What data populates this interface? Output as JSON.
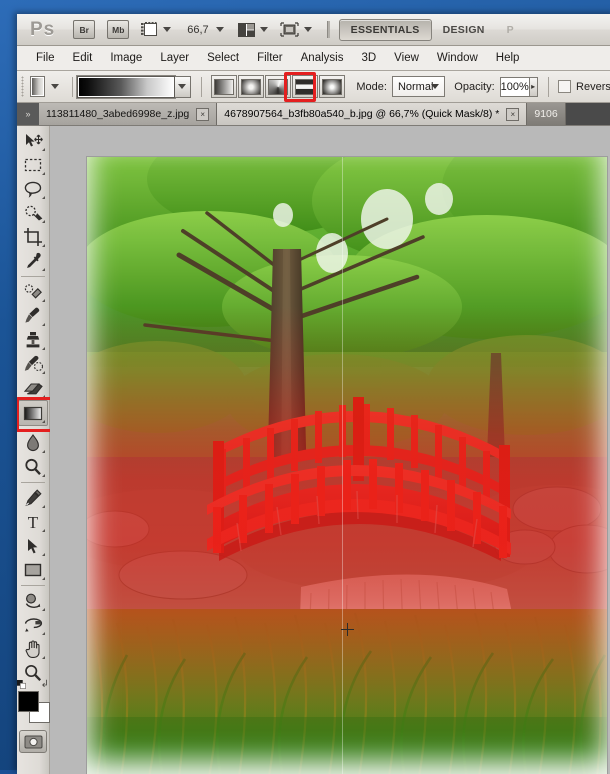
{
  "app": {
    "logo": "Ps",
    "bridge_label": "Br",
    "minibridge_label": "Mb",
    "zoom_level": "66,7",
    "workspace_tabs": [
      {
        "label": "ESSENTIALS",
        "active": true
      },
      {
        "label": "DESIGN",
        "active": false
      },
      {
        "label": "P",
        "active": false
      }
    ],
    "icons": {
      "view_extras": "view-extras-icon",
      "arrange_documents": "arrange-documents-icon",
      "screen_mode": "screen-mode-icon"
    }
  },
  "menu": {
    "items": [
      "File",
      "Edit",
      "Image",
      "Layer",
      "Select",
      "Filter",
      "Analysis",
      "3D",
      "View",
      "Window",
      "Help"
    ]
  },
  "options_bar": {
    "tool_preset_name": "gradient-tool-preset",
    "gradient_preset_name": "Black, White",
    "gradient_types": [
      {
        "name": "linear-gradient-button",
        "selected": false
      },
      {
        "name": "radial-gradient-button",
        "selected": false
      },
      {
        "name": "angle-gradient-button",
        "selected": false
      },
      {
        "name": "reflected-gradient-button",
        "selected": true
      },
      {
        "name": "diamond-gradient-button",
        "selected": false
      }
    ],
    "mode_label": "Mode:",
    "mode_value": "Normal",
    "opacity_label": "Opacity:",
    "opacity_value": "100%",
    "reverse_label": "Reverse",
    "reverse_checked": false,
    "highlight_color": "#e41f1f"
  },
  "tabs": [
    {
      "title": "113811480_3abed6998e_z.jpg",
      "active": false,
      "close": "×"
    },
    {
      "title": "4678907564_b3fb80a540_b.jpg @ 66,7% (Quick Mask/8) *",
      "active": true,
      "close": "×"
    },
    {
      "title": "9106",
      "active": false,
      "close": ""
    }
  ],
  "toolbox": {
    "tools": [
      {
        "name": "move-tool",
        "label": "Move Tool",
        "selected": false,
        "divider_after": false
      },
      {
        "name": "rectangular-marquee-tool",
        "label": "Rectangular Marquee Tool",
        "selected": false,
        "divider_after": false
      },
      {
        "name": "lasso-tool",
        "label": "Lasso Tool",
        "selected": false,
        "divider_after": false
      },
      {
        "name": "quick-selection-tool",
        "label": "Quick Selection Tool",
        "selected": false,
        "divider_after": false
      },
      {
        "name": "crop-tool",
        "label": "Crop Tool",
        "selected": false,
        "divider_after": false
      },
      {
        "name": "eyedropper-tool",
        "label": "Eyedropper Tool",
        "selected": false,
        "divider_after": true
      },
      {
        "name": "spot-healing-brush-tool",
        "label": "Spot Healing Brush Tool",
        "selected": false,
        "divider_after": false
      },
      {
        "name": "brush-tool",
        "label": "Brush Tool",
        "selected": false,
        "divider_after": false
      },
      {
        "name": "clone-stamp-tool",
        "label": "Clone Stamp Tool",
        "selected": false,
        "divider_after": false
      },
      {
        "name": "history-brush-tool",
        "label": "History Brush Tool",
        "selected": false,
        "divider_after": false
      },
      {
        "name": "eraser-tool",
        "label": "Eraser Tool",
        "selected": false,
        "divider_after": false
      },
      {
        "name": "gradient-tool",
        "label": "Gradient Tool",
        "selected": true,
        "divider_after": false
      },
      {
        "name": "blur-tool",
        "label": "Blur Tool",
        "selected": false,
        "divider_after": false
      },
      {
        "name": "dodge-tool",
        "label": "Dodge Tool",
        "selected": false,
        "divider_after": true
      },
      {
        "name": "pen-tool",
        "label": "Pen Tool",
        "selected": false,
        "divider_after": false
      },
      {
        "name": "horizontal-type-tool",
        "label": "Horizontal Type Tool",
        "selected": false,
        "divider_after": false
      },
      {
        "name": "path-selection-tool",
        "label": "Path Selection Tool",
        "selected": false,
        "divider_after": false
      },
      {
        "name": "rectangle-tool",
        "label": "Rectangle Tool",
        "selected": false,
        "divider_after": true
      },
      {
        "name": "3d-object-rotate-tool",
        "label": "3D Object Rotate Tool",
        "selected": false,
        "divider_after": false
      },
      {
        "name": "3d-rotate-camera-tool",
        "label": "3D Rotate Camera Tool",
        "selected": false,
        "divider_after": false
      },
      {
        "name": "hand-tool",
        "label": "Hand Tool",
        "selected": false,
        "divider_after": false
      },
      {
        "name": "zoom-tool",
        "label": "Zoom Tool",
        "selected": false,
        "divider_after": false
      }
    ],
    "foreground_color": "#000000",
    "background_color": "#ffffff",
    "quick_mask_name": "edit-in-quick-mask-mode-button",
    "highlight_color": "#e41f1f"
  },
  "document": {
    "scene": "red arched japanese garden bridge over a stream with small waterfall, tall green trees and grass in foreground",
    "quick_mask_overlay_color": "#dc1414",
    "canvas_background": "#b9b9b9",
    "cursor": "crosshair-cursor"
  }
}
